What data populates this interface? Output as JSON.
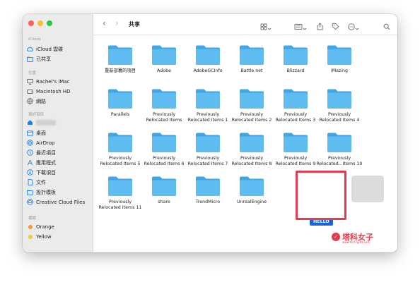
{
  "colors": {
    "folder_front": "#5fbcf1",
    "folder_back": "#3fa6e6",
    "accent": "#1d7ef5",
    "highlight_box": "#e43a4b",
    "selection": "#1a62d5"
  },
  "window": {
    "title": "共享"
  },
  "sidebar": {
    "icloud_header": "iCloud",
    "icloud_items": [
      {
        "label": "iCloud 雲碟",
        "icon": "cloud-icon"
      },
      {
        "label": "已共享",
        "icon": "shared-folder-icon"
      }
    ],
    "locations_header": "位置",
    "locations_items": [
      {
        "label": "Rachel's iMac",
        "icon": "imac-icon"
      },
      {
        "label": "Macintosh HD",
        "icon": "disk-icon"
      },
      {
        "label": "網路",
        "icon": "globe-icon"
      }
    ],
    "favorites_header": "喜好項目",
    "favorites_items": [
      {
        "label": "桌面",
        "icon": "desktop-icon"
      },
      {
        "label": "AirDrop",
        "icon": "airdrop-icon"
      },
      {
        "label": "最近項目",
        "icon": "clock-icon"
      },
      {
        "label": "應用程式",
        "icon": "applications-icon"
      },
      {
        "label": "下載項目",
        "icon": "download-icon"
      },
      {
        "label": "文件",
        "icon": "document-icon"
      },
      {
        "label": "設計模板",
        "icon": "folder-icon"
      },
      {
        "label": "Creative Cloud Files",
        "icon": "creative-cloud-icon"
      }
    ],
    "tags_header": "標籤",
    "tags": [
      {
        "label": "Orange",
        "color": "#f39a2b"
      },
      {
        "label": "Yellow",
        "color": "#f4cb2f"
      }
    ]
  },
  "toolbar": {
    "back": "‹",
    "forward": "›",
    "view_icon": "grid-icon",
    "group_icon": "group-icon",
    "share_icon": "share-icon",
    "tag_icon": "tag-icon",
    "more_icon": "more-icon",
    "search_icon": "search-icon"
  },
  "folders": [
    {
      "lines": [
        "重新部署的項目"
      ]
    },
    {
      "lines": [
        "Adobe"
      ]
    },
    {
      "lines": [
        "AdobeGCInfo"
      ]
    },
    {
      "lines": [
        "Battle.net"
      ]
    },
    {
      "lines": [
        "Blizzard"
      ]
    },
    {
      "lines": [
        "iMazing"
      ]
    },
    {
      "lines": [
        "Parallels"
      ]
    },
    {
      "lines": [
        "Previously",
        "Relocated Items"
      ]
    },
    {
      "lines": [
        "Previously",
        "Relocated Items 1"
      ]
    },
    {
      "lines": [
        "Previously",
        "Relocated Items 2"
      ]
    },
    {
      "lines": [
        "Previously",
        "Relocated Items 3"
      ]
    },
    {
      "lines": [
        "Previously",
        "Relocated Items 4"
      ]
    },
    {
      "lines": [
        "Previously",
        "Relocated Items 5"
      ]
    },
    {
      "lines": [
        "Previously",
        "Relocated Items 6"
      ]
    },
    {
      "lines": [
        "Previously",
        "Relocated Items 7"
      ]
    },
    {
      "lines": [
        "Previously",
        "Relocated Items 8"
      ]
    },
    {
      "lines": [
        "Previously",
        "Relocated Items 9"
      ]
    },
    {
      "lines": [
        "Previously",
        "Relocated...Items 10"
      ]
    },
    {
      "lines": [
        "Previously",
        "Relocated Items 11"
      ]
    },
    {
      "lines": [
        "share"
      ]
    },
    {
      "lines": [
        "TrendMicro"
      ]
    },
    {
      "lines": [
        "UnrealEngine"
      ]
    }
  ],
  "selected_folder": {
    "label": "HELLO"
  },
  "watermark": {
    "text": "塔科女子",
    "url": "www.tech-girlz.com"
  }
}
